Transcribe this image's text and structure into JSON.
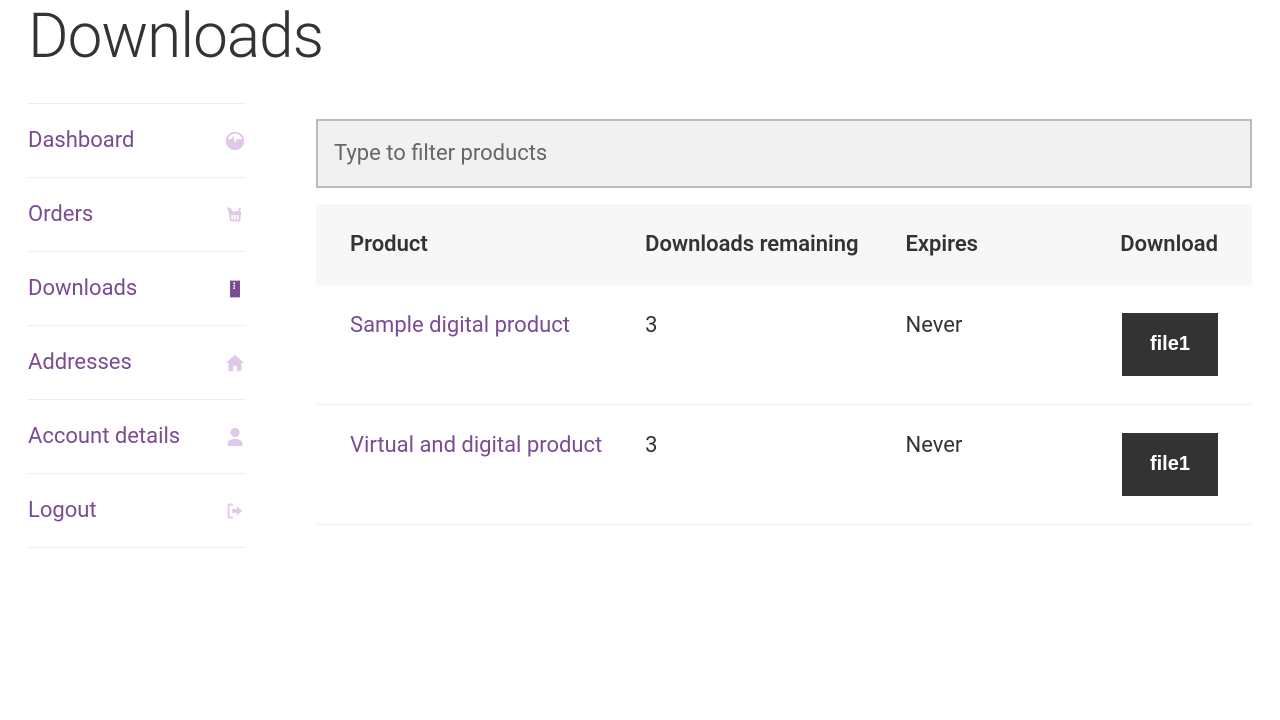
{
  "page": {
    "title": "Downloads"
  },
  "sidebar": {
    "items": [
      {
        "label": "Dashboard",
        "icon": "dashboard"
      },
      {
        "label": "Orders",
        "icon": "basket"
      },
      {
        "label": "Downloads",
        "icon": "archive"
      },
      {
        "label": "Addresses",
        "icon": "home"
      },
      {
        "label": "Account details",
        "icon": "user"
      },
      {
        "label": "Logout",
        "icon": "signout"
      }
    ],
    "active_index": 2
  },
  "filter": {
    "placeholder": "Type to filter products",
    "value": ""
  },
  "table": {
    "headers": {
      "product": "Product",
      "remaining": "Downloads remaining",
      "expires": "Expires",
      "download": "Download"
    },
    "rows": [
      {
        "product": "Sample digital product",
        "remaining": "3",
        "expires": "Never",
        "download_label": "file1"
      },
      {
        "product": "Virtual and digital product",
        "remaining": "3",
        "expires": "Never",
        "download_label": "file1"
      }
    ]
  }
}
